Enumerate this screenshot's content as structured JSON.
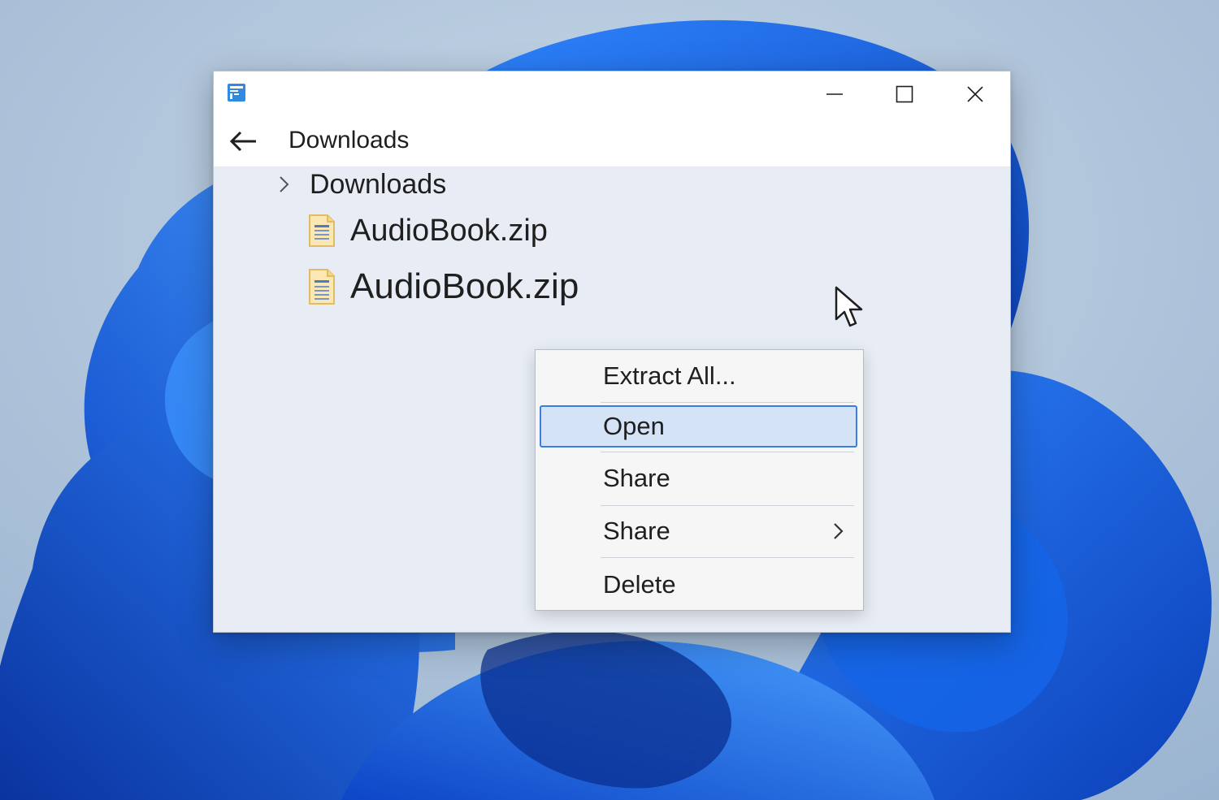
{
  "window": {
    "app_icon": "file-explorer-icon",
    "controls": [
      "minimize-icon",
      "maximize-icon",
      "close-icon"
    ]
  },
  "nav": {
    "back_icon": "back-arrow-icon",
    "title": "Downloads"
  },
  "tree": {
    "folder": {
      "label": "Downloads",
      "icon": "chevron-right-icon"
    },
    "files": [
      {
        "label": "AudioBook.zip",
        "icon": "document-icon"
      },
      {
        "label": "AudioBook.zip",
        "icon": "document-icon"
      }
    ]
  },
  "context_menu": {
    "items": [
      {
        "label": "Extract All..."
      },
      {
        "label": "Open",
        "highlighted": true
      },
      {
        "label": "Share"
      },
      {
        "label": "Share",
        "submenu": true
      },
      {
        "label": "Delete"
      }
    ],
    "highlight_color": "#d4e3f6",
    "highlight_border": "#3c7ee0"
  },
  "colors": {
    "desktop_bg": "#aac2dc",
    "bloom_blue": "#1a5fe0",
    "window_bg": "#e8edf5",
    "titlebar_bg": "#ffffff"
  }
}
